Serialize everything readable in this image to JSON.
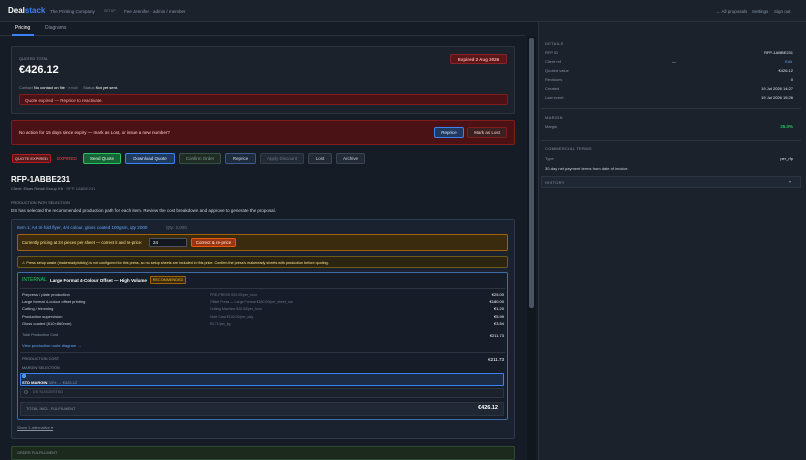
{
  "topbar": {
    "logo_a": "Deal",
    "logo_b": "stack",
    "company": "The Printing Company",
    "tag": "SETUP",
    "user": "Fee Jennifer · admin / member",
    "all_proposals": "← All proposals",
    "settings": "Settings",
    "sign_out": "Sign out"
  },
  "tabs": [
    "Pricing",
    "Diagrams"
  ],
  "quote": {
    "label": "QUOTED TOTAL",
    "total": "€426.12",
    "expired_badge": "Expired 2 Aug 2026",
    "contact_label": "Contact",
    "contact_value": "No contact on file",
    "email": "email",
    "status_label": "Status",
    "status_value": "Not yet sent.",
    "alert": "Quote expired — Reprice to reactivate."
  },
  "action_banner": {
    "text": "No action for 15 days since expiry — mark as Lost, or issue a new number?",
    "reprice": "Reprice",
    "mark_lost": "Mark as Lost"
  },
  "statusbar": {
    "badge": "QUOTE EXPIRED",
    "state": "EXPIRED",
    "send": "Send Quote",
    "download": "Download Quote",
    "confirm": "Confirm Order",
    "reprice": "Reprice",
    "apply_discount": "Apply Discount",
    "lost": "Lost",
    "archive": "Archive"
  },
  "rfp": {
    "id": "RFP-1ABBE231",
    "client": "Client: Elsas Retail Group Kft",
    "ref": "RFP-1ABBE231",
    "section": "PRODUCTION PATH SELECTION",
    "desc": "DS has selected the recommended production path for each item. Review the cost breakdown and approve to generate the proposal."
  },
  "item": {
    "title": "Item 1: A4 tri-fold flyer, 4/4 colour, gloss coated 100gsm, qty 2000",
    "qty": "Qty: 2,000",
    "pricing_text": "Currently pricing at 24 pieces per sheet — correct it and re-price:",
    "pieces_value": "24",
    "correct_btn": "Correct & re-price",
    "warning": "⚠ Press setup waste (makeready/sticky) is not configured for this press, so no setup sheets are included in this price. Confirm the press's makeready sheets with production before quoting."
  },
  "path": {
    "badge": "INTERNAL",
    "name": "Large Format 4-Colour Offset — High Volume",
    "recommended": "RECOMMENDED",
    "rows": [
      {
        "label": "Prepress / plate production",
        "note": "PRE-PRESS €25.00/per_hour",
        "value": "€25.00"
      },
      {
        "label": "Large format 4-colour offset printing",
        "note": "Offset Press — Large Format €180.00/per_sheet_run",
        "value": "€180.00"
      },
      {
        "label": "Cutting / trimming",
        "note": "Cutting Machine €20.00/per_hour",
        "value": "€1.20"
      },
      {
        "label": "Production supervision",
        "note": "Note Card €100.00/per_day",
        "value": "€5.99"
      },
      {
        "label": "Gloss coated (610×860mm)",
        "note": "€0.71/per_kg",
        "value": "€3.54"
      }
    ],
    "total_label": "Total Production Cost",
    "total_value": "€211.73",
    "diagram_link": "View production route diagram →",
    "production_cost_label": "PRODUCTION COST",
    "production_cost_value": "€211.73",
    "margin_label": "MARGIN SELECTION",
    "margin_selected": "STD MARGIN",
    "margin_pct": "35%",
    "margin_arrow": "→ €426.12",
    "margin_other": "DS SUGGESTED",
    "total_incl_label": "TOTAL INCL. FULFILMENT",
    "total_incl_value": "€426.12",
    "show_alt": "Show 1 alternative ▾"
  },
  "order_fulfilment": "ORDER FULFILLMENT",
  "sidebar": {
    "details_h": "DETAILS",
    "details": [
      {
        "label": "RFP ID",
        "value": "RFP-1ABBE231"
      },
      {
        "label": "Client ref",
        "value": "—"
      },
      {
        "label": "Quoted value",
        "value": "€426.12"
      },
      {
        "label": "Revisions",
        "value": "0"
      },
      {
        "label": "Created",
        "value": "19 Jul 2026 14:27"
      },
      {
        "label": "Last event",
        "value": "19 Jul 2026 15:26"
      }
    ],
    "edit": "Edit",
    "margin_h": "MARGIN",
    "margin_label": "Margin",
    "margin_value": "35.0%",
    "terms_h": "COMMERCIAL TERMS",
    "type_label": "Type",
    "type_value": "per_rfp",
    "terms_text": "30-day net payment terms from date of invoice.",
    "history_h": "HISTORY"
  },
  "colors": {
    "accent": "#3b82f6",
    "danger": "#ef4444",
    "success": "#22c55e",
    "warning": "#f59e0b"
  }
}
